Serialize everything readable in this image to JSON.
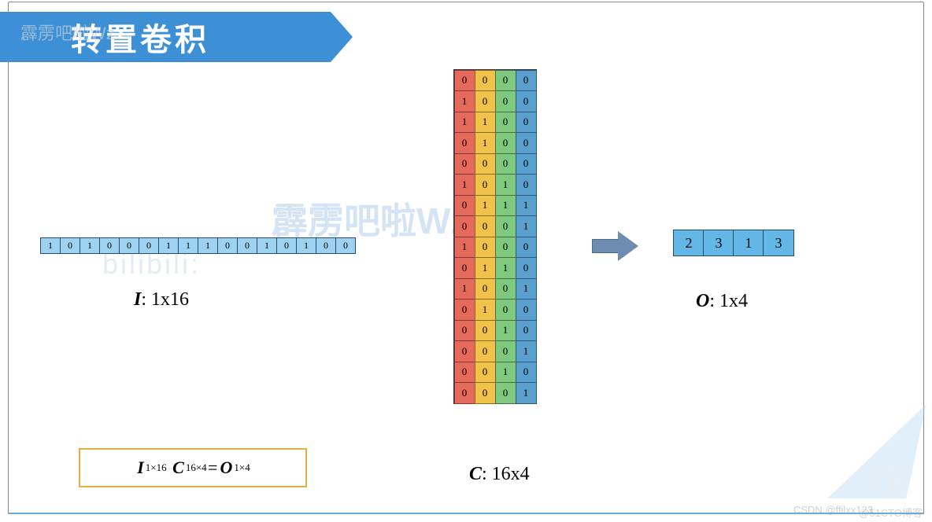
{
  "title": "转置卷积",
  "watermarks": {
    "wm1": "霹雳吧啦Wz",
    "wm2": "霹雳吧啦Wz",
    "wm3": "bilibili:",
    "wm4": "CSDN @ffilxx123",
    "wm5": "@51CTO博客"
  },
  "matrix_i": {
    "label_var": "I",
    "label_shape": ": 1x16",
    "values": [
      1,
      0,
      1,
      0,
      0,
      0,
      1,
      1,
      1,
      0,
      0,
      1,
      0,
      1,
      0,
      0
    ]
  },
  "matrix_c": {
    "label_var": "C",
    "label_shape": ": 16x4",
    "col_colors": [
      "c0",
      "c1",
      "c2",
      "c3"
    ],
    "rows": [
      [
        0,
        0,
        0,
        0
      ],
      [
        1,
        0,
        0,
        0
      ],
      [
        1,
        1,
        0,
        0
      ],
      [
        0,
        1,
        0,
        0
      ],
      [
        0,
        0,
        0,
        0
      ],
      [
        1,
        0,
        1,
        0
      ],
      [
        0,
        1,
        1,
        1
      ],
      [
        0,
        0,
        0,
        1
      ],
      [
        1,
        0,
        0,
        0
      ],
      [
        0,
        1,
        1,
        0
      ],
      [
        1,
        0,
        0,
        1
      ],
      [
        0,
        1,
        0,
        0
      ],
      [
        0,
        0,
        1,
        0
      ],
      [
        0,
        0,
        0,
        1
      ],
      [
        0,
        0,
        1,
        0
      ],
      [
        0,
        0,
        0,
        1
      ]
    ]
  },
  "matrix_o": {
    "label_var": "O",
    "label_shape": ": 1x4",
    "values": [
      2,
      3,
      1,
      3
    ]
  },
  "formula": {
    "lhs_i": "I",
    "sup_i": "1×16",
    "lhs_c": "C",
    "sup_c": "16×4",
    "eq": " = ",
    "rhs_o": "O",
    "sup_o": "1×4"
  }
}
